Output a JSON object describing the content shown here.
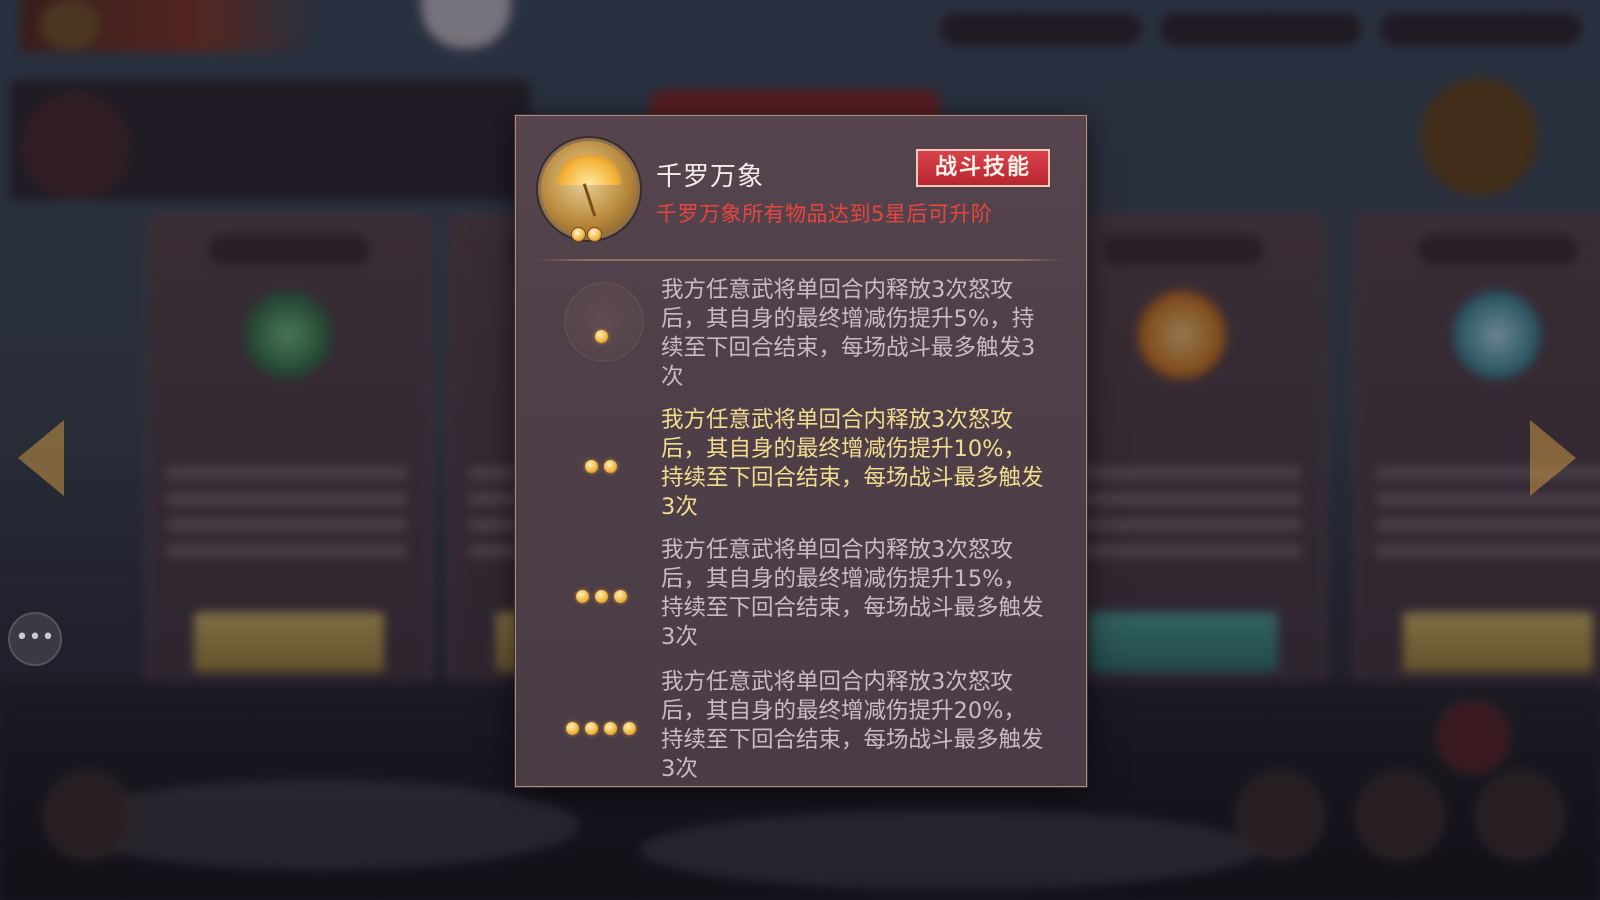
{
  "popup": {
    "skill_name": "千罗万象",
    "skill_tag": "战斗技能",
    "upgrade_note": "千罗万象所有物品达到5星后可升阶",
    "icon": "umbrella-icon",
    "tiers": [
      {
        "stars": 1,
        "text": "我方任意武将单回合内释放3次怒攻后，其自身的最终增减伤提升5%，持续至下回合结束，每场战斗最多触发3次"
      },
      {
        "stars": 2,
        "text": "我方任意武将单回合内释放3次怒攻后，其自身的最终增减伤提升10%，持续至下回合结束，每场战斗最多触发3次"
      },
      {
        "stars": 3,
        "text": "我方任意武将单回合内释放3次怒攻后，其自身的最终增减伤提升15%，持续至下回合结束，每场战斗最多触发3次"
      },
      {
        "stars": 4,
        "text": "我方任意武将单回合内释放3次怒攻后，其自身的最终增减伤提升20%，持续至下回合结束，每场战斗最多触发3次"
      }
    ],
    "active_tier": 2
  },
  "colors": {
    "tag_red": "#c8303a",
    "note_red": "#e8453f",
    "active_text": "#f1dc90",
    "inactive_text": "#c8bcc2"
  },
  "background": {
    "chat_icon": "chat-bubble-icon",
    "nav_left_icon": "chevron-left-icon",
    "nav_right_icon": "chevron-right-icon"
  }
}
